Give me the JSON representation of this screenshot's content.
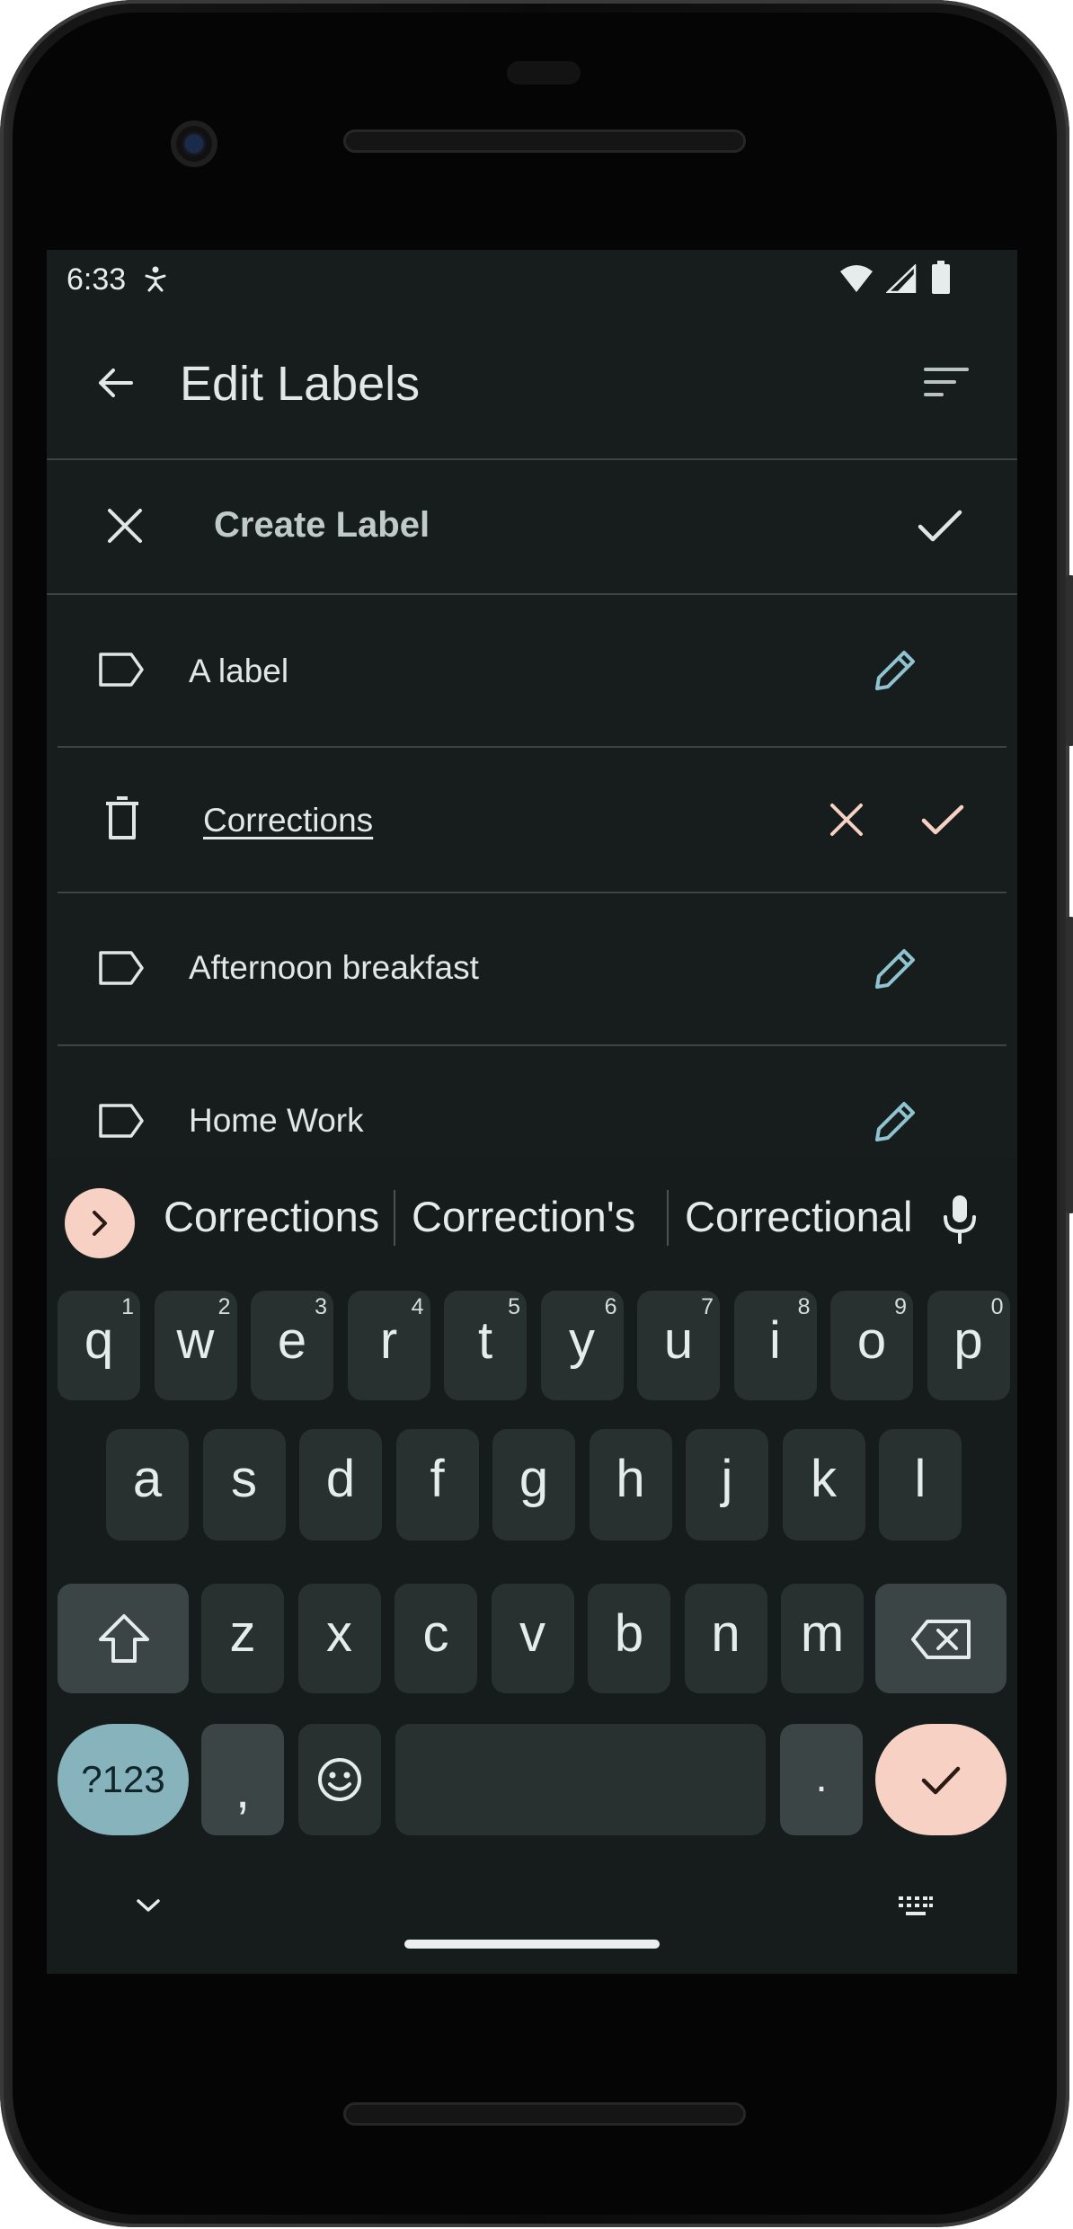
{
  "status": {
    "time": "6:33"
  },
  "appbar": {
    "title": "Edit Labels"
  },
  "create": {
    "placeholder": "Create Label"
  },
  "labels": [
    {
      "name": "A label",
      "editing": false
    },
    {
      "name": "Corrections",
      "editing": true
    },
    {
      "name": "Afternoon breakfast",
      "editing": false
    },
    {
      "name": "Home Work",
      "editing": false
    }
  ],
  "keyboard": {
    "suggestions": [
      "Corrections",
      "Correction's",
      "Correctional"
    ],
    "row1": [
      {
        "ch": "q",
        "sup": "1"
      },
      {
        "ch": "w",
        "sup": "2"
      },
      {
        "ch": "e",
        "sup": "3"
      },
      {
        "ch": "r",
        "sup": "4"
      },
      {
        "ch": "t",
        "sup": "5"
      },
      {
        "ch": "y",
        "sup": "6"
      },
      {
        "ch": "u",
        "sup": "7"
      },
      {
        "ch": "i",
        "sup": "8"
      },
      {
        "ch": "o",
        "sup": "9"
      },
      {
        "ch": "p",
        "sup": "0"
      }
    ],
    "row2": [
      "a",
      "s",
      "d",
      "f",
      "g",
      "h",
      "j",
      "k",
      "l"
    ],
    "row3": [
      "z",
      "x",
      "c",
      "v",
      "b",
      "n",
      "m"
    ],
    "symbols_label": "?123",
    "comma": ",",
    "period": "."
  },
  "colors": {
    "screen_bg": "#171d1d",
    "accent_peach": "#f6d1c4",
    "accent_teal": "#87b3bd",
    "edit_icon": "#8fc3cf",
    "key_bg": "#283130"
  }
}
